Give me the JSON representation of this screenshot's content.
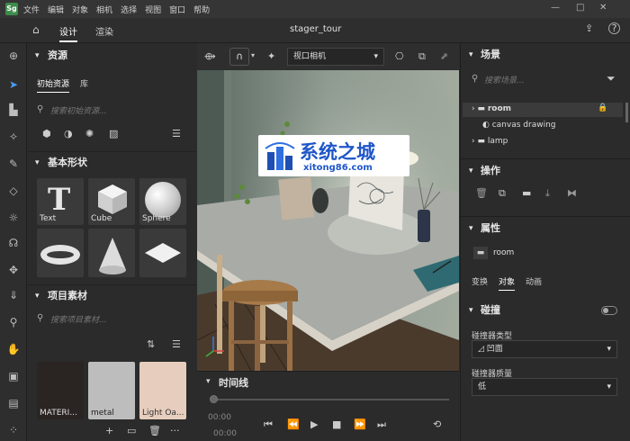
{
  "app": {
    "logo": "Sg",
    "title": "stager_tour"
  },
  "menu": [
    "文件",
    "编辑",
    "对象",
    "相机",
    "选择",
    "视图",
    "窗口",
    "帮助"
  ],
  "tabs": {
    "design": "设计",
    "render": "渲染"
  },
  "left": {
    "assets_title": "资源",
    "subtabs": [
      "初始资源",
      "库"
    ],
    "search_placeholder": "搜索初始资源...",
    "shapes_title": "基本形状",
    "shapes": [
      "Text",
      "Cube",
      "Sphere",
      "",
      "",
      ""
    ],
    "project_title": "项目素材",
    "project_search": "搜索项目素材...",
    "materials": [
      "MATERI...",
      "metal",
      "Light Oa..."
    ]
  },
  "viewport": {
    "camera": "视口相机"
  },
  "timeline": {
    "title": "时间线",
    "time1": "00:00",
    "time2": "00:00"
  },
  "right": {
    "scene_title": "场景",
    "scene_search": "搜索场景...",
    "tree": [
      "room",
      "canvas drawing",
      "lamp"
    ],
    "ops_title": "操作",
    "props_title": "属性",
    "props_object": "room",
    "prop_tabs": [
      "变换",
      "对象",
      "动画"
    ],
    "collision_title": "碰撞",
    "collider_type_label": "碰撞器类型",
    "collider_type_value": "凹面",
    "collider_quality_label": "碰撞器质量",
    "collider_quality_value": "低"
  },
  "watermark": {
    "title": "系统之城",
    "url": "xitong86.com"
  },
  "colors": {
    "accent": "#4a7cf0",
    "bg": "#2b2b2b"
  }
}
